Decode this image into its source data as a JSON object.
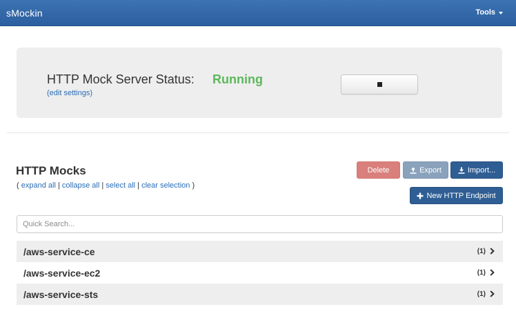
{
  "navbar": {
    "brand": "sMockin",
    "tools_label": "Tools"
  },
  "status_panel": {
    "title": "HTTP Mock Server Status:",
    "status": "Running",
    "status_color": "#5cb85c",
    "edit_link": "(edit settings)",
    "stop_button_icon": "stop-icon"
  },
  "mocks": {
    "title": "HTTP Mocks",
    "links": {
      "open": "( ",
      "expand_all": "expand all",
      "collapse_all": "collapse all",
      "select_all": "select all",
      "clear_selection": "clear selection",
      "separator": " | ",
      "close": " )"
    },
    "buttons": {
      "delete": "Delete",
      "export": "Export",
      "import": "Import...",
      "new_endpoint": "New HTTP Endpoint"
    },
    "search_placeholder": "Quick Search...",
    "search_value": "",
    "endpoints": [
      {
        "path": "/aws-service-ce",
        "count": "(1)"
      },
      {
        "path": "/aws-service-ec2",
        "count": "(1)"
      },
      {
        "path": "/aws-service-sts",
        "count": "(1)"
      }
    ]
  },
  "colors": {
    "navbar": "#2f66a8",
    "delete": "#d9807c",
    "export": "#8aa2bb",
    "primary": "#2f5e94",
    "link": "#2a6db5"
  }
}
